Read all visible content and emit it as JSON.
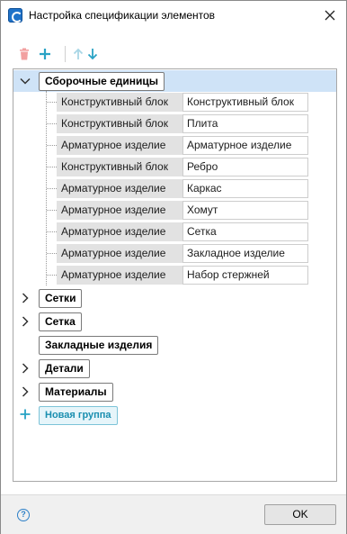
{
  "window": {
    "title": "Настройка спецификации элементов"
  },
  "toolbar": {
    "delete_icon": "trash-icon",
    "add_icon": "plus-icon",
    "up_icon": "arrow-up-icon",
    "down_icon": "arrow-down-icon",
    "colors": {
      "delete": "#f2a0a0",
      "add": "#2aa3c5",
      "up_disabled": "#a9d6e6",
      "down": "#2aa3c5"
    }
  },
  "tree": {
    "groups": [
      {
        "label": "Сборочные единицы",
        "expanded": true,
        "selected": true
      },
      {
        "label": "Сетки",
        "expanded": false
      },
      {
        "label": "Сетка",
        "expanded": false
      },
      {
        "label": "Закладные изделия",
        "expanded": null
      },
      {
        "label": "Детали",
        "expanded": false
      },
      {
        "label": "Материалы",
        "expanded": false
      }
    ],
    "children": [
      {
        "type": "Конструктивный блок",
        "name": "Конструктивный блок"
      },
      {
        "type": "Конструктивный блок",
        "name": "Плита"
      },
      {
        "type": "Арматурное изделие",
        "name": "Арматурное изделие"
      },
      {
        "type": "Конструктивный блок",
        "name": "Ребро"
      },
      {
        "type": "Арматурное изделие",
        "name": "Каркас"
      },
      {
        "type": "Арматурное изделие",
        "name": "Хомут"
      },
      {
        "type": "Арматурное изделие",
        "name": "Сетка"
      },
      {
        "type": "Арматурное изделие",
        "name": "Закладное изделие"
      },
      {
        "type": "Арматурное изделие",
        "name": "Набор стержней"
      }
    ],
    "new_group_label": "Новая группа",
    "selection_color": "#cfe3f7",
    "accent_color": "#26a2c4"
  },
  "footer": {
    "help_label": "?",
    "ok_label": "OK"
  }
}
